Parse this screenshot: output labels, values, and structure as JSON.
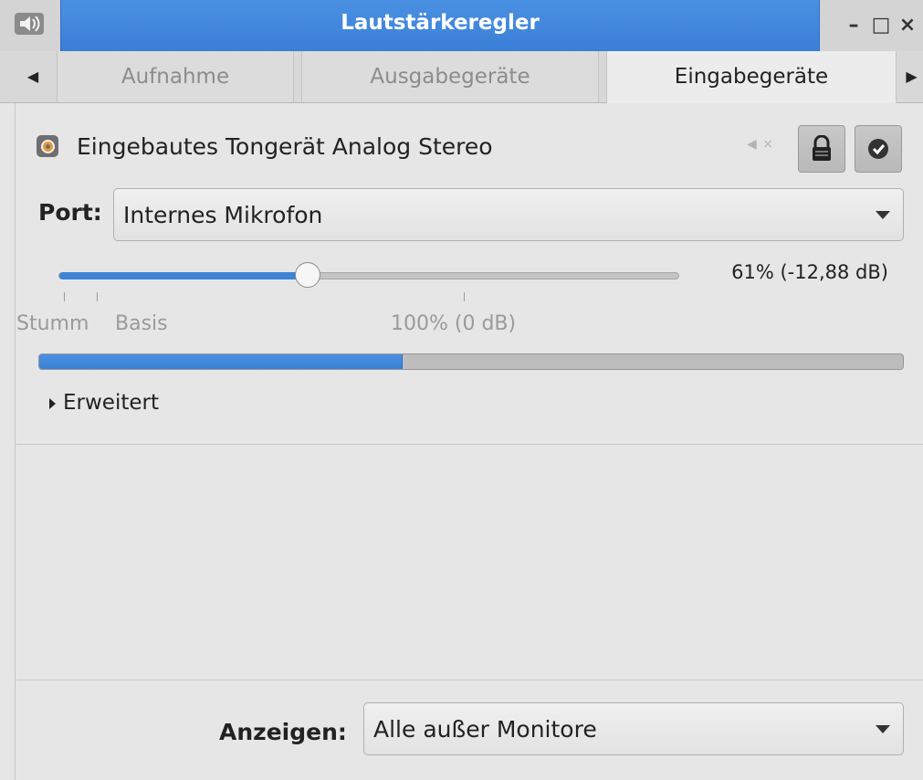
{
  "window": {
    "title": "Lautstärkeregler",
    "app_icon": "speaker-icon",
    "buttons": {
      "minimize": "–",
      "maximize": "□",
      "close": "×"
    }
  },
  "tabs": [
    {
      "label": "Aufnahme",
      "active": false
    },
    {
      "label": "Ausgabegeräte",
      "active": false
    },
    {
      "label": "Eingabegeräte",
      "active": true
    }
  ],
  "device": {
    "name": "Eingebautes Tongerät Analog Stereo",
    "icon": "audio-card-icon",
    "mute_icon": "speaker-muted-icon",
    "lock_icon": "lock-icon",
    "default_icon": "check-circle-icon"
  },
  "port": {
    "label": "Port:",
    "value": "Internes Mikrofon"
  },
  "volume": {
    "readout": "61% (-12,88 dB)",
    "percent": 61,
    "marks": {
      "mute": "Stumm",
      "base": "Basis",
      "hundred": "100% (0 dB)"
    }
  },
  "level_meter": {
    "fraction": 0.42
  },
  "advanced": {
    "label": "Erweitert",
    "expanded": false
  },
  "footer": {
    "show_label": "Anzeigen:",
    "show_value": "Alle außer Monitore"
  },
  "colors": {
    "accent": "#3d84d6",
    "background": "#e6e6e6"
  }
}
